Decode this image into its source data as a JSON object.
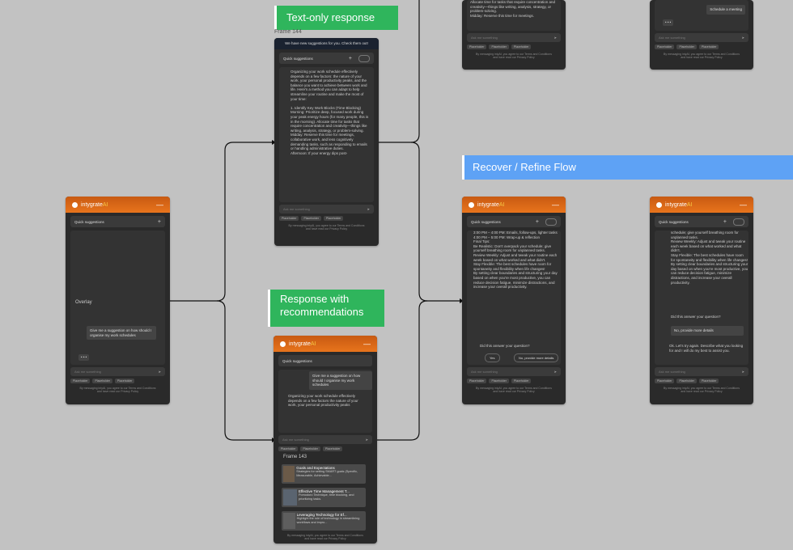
{
  "labels": {
    "text_only": "Text-only response",
    "response_recs": "Response with recommendations",
    "recover_flow": "Recover / Refine Flow",
    "frame144": "Frame 144",
    "frame143": "Frame 143"
  },
  "app": {
    "brand": "intygrate",
    "brand_ai": "AI",
    "quick_suggestions": "Quick suggestions",
    "input_placeholder": "Ask me something",
    "tags": [
      "Placeholder",
      "Placeholder",
      "Placeholder"
    ],
    "footer_line1": "By messaging intyAI, you agree to our Terms and Conditions",
    "footer_line2": "and have read our Privacy Policy",
    "banner": "We have new suggestions for you. Check them out!",
    "overlay": "Overlay",
    "user_msg": "Give me a suggestion on how should I organise my work schedules",
    "typing": "• • •",
    "meeting_chip": "Schedule a meeting"
  },
  "text_response": "Organizing your work schedule effectively depends on a few factors: the nature of your work, your personal productivity peaks, and the balance you want to achieve between work and life. Here's a method you can adapt to help streamline your routine and make the most of your time:\n\n1. Identify Key Work Blocks (Time Blocking)\nMorning: Prioritize deep, focused work during your peak energy hours (for many people, this is in the morning). Allocate time for tasks that require concentration and creativity—things like writing, analysis, strategy, or problem-solving.\nMidday: Reserve this time for meetings, collaborative work, and less cognitively demanding tasks, such as responding to emails or handling administrative duties.\nAfternoon: If your energy dips post-",
  "top_partial_text": "Allocate time for tasks that require concentration and creativity—things like writing, analysis, strategy, or problem-solving.\nMidday: Reserve this time for meetings.",
  "short_response": "Organizing your work schedule effectively depends on a few factors the nature of your work, your personal productivity peaks",
  "refine_text": "3:00 PM – 4:00 PM: Emails, follow-ups, lighter tasks\n4:00 PM – 5:00 PM: Wrap-up & reflection\nFinal Tips:\nBe Realistic: Don't overpack your schedule; give yourself breathing room for unplanned tasks.\nReview Weekly: Adjust and tweak your routine each week based on what worked and what didn't.\nStay Flexible: The best schedules have room for spontaneity and flexibility when life changes!\nBy setting clear boundaries and structuring your day based on when you're most productive, you can reduce decision fatigue, minimize distractions, and increase your overall productivity.",
  "refine_text2": "schedule; give yourself breathing room for unplanned tasks.\nReview Weekly: Adjust and tweak your routine each week based on what worked and what didn't.\nStay Flexible: The best schedules have room for spontaneity and flexibility when life changes!\nBy setting clear boundaries and structuring your day based on when you're most productive, you can reduce decision fatigue, minimize distractions, and increase your overall productivity.",
  "question": "Did this answer your question?",
  "yes": "Yes",
  "no_more": "No, provide more details",
  "retry": "Ok. Let's try again. Describe what you looking for and I will do my best to assist you.",
  "recs": [
    {
      "title": "Goals and Expectations",
      "sub": "Strategies for setting SMART goals (Specific, Measurable, Achievable..."
    },
    {
      "title": "Effective Time Management T...",
      "sub": "Pomodoro Technique, time blocking, and prioritizing tasks."
    },
    {
      "title": "Leveraging Technology for Ef...",
      "sub": "Highlight the role of technology in streamlining workflows and impro..."
    }
  ]
}
